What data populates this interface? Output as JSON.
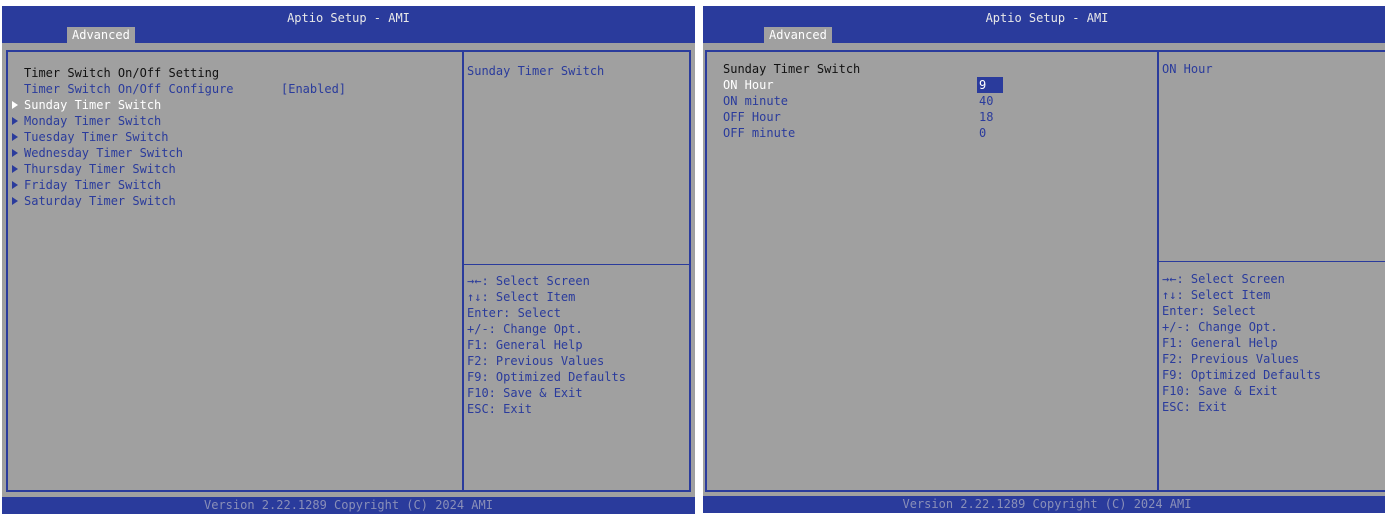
{
  "screens": [
    {
      "title": "Aptio Setup - AMI",
      "tab": "Advanced",
      "left": {
        "heading": "Timer Switch On/Off Setting",
        "config_label": "Timer Switch On/Off Configure",
        "config_value": "[Enabled]",
        "items": [
          {
            "label": "Sunday Timer Switch",
            "selected": true
          },
          {
            "label": "Monday Timer Switch"
          },
          {
            "label": "Tuesday Timer Switch"
          },
          {
            "label": "Wednesday Timer Switch"
          },
          {
            "label": "Thursday Timer Switch"
          },
          {
            "label": "Friday Timer Switch"
          },
          {
            "label": "Saturday Timer Switch"
          }
        ]
      },
      "help": "Sunday Timer Switch",
      "keys": [
        "→←: Select Screen",
        "↑↓: Select Item",
        "Enter: Select",
        "+/-: Change Opt.",
        "F1: General Help",
        "F2: Previous Values",
        "F9: Optimized Defaults",
        "F10: Save & Exit",
        "ESC: Exit"
      ],
      "footer": "Version 2.22.1289 Copyright (C) 2024 AMI"
    },
    {
      "title": "Aptio Setup - AMI",
      "tab": "Advanced",
      "left": {
        "heading": "Sunday Timer Switch",
        "fields": [
          {
            "label": "ON Hour",
            "value": "9",
            "selected": true
          },
          {
            "label": "ON minute",
            "value": "40"
          },
          {
            "label": "OFF Hour",
            "value": "18"
          },
          {
            "label": "OFF minute",
            "value": "0"
          }
        ]
      },
      "help": "ON Hour",
      "keys": [
        "→←: Select Screen",
        "↑↓: Select Item",
        "Enter: Select",
        "+/-: Change Opt.",
        "F1: General Help",
        "F2: Previous Values",
        "F9: Optimized Defaults",
        "F10: Save & Exit",
        "ESC: Exit"
      ],
      "footer": "Version 2.22.1289 Copyright (C) 2024 AMI"
    }
  ],
  "colors": {
    "bg": "#a0a0a0",
    "accent": "#2a3b9c",
    "text": "#111111",
    "highlight": "#ffffff"
  }
}
